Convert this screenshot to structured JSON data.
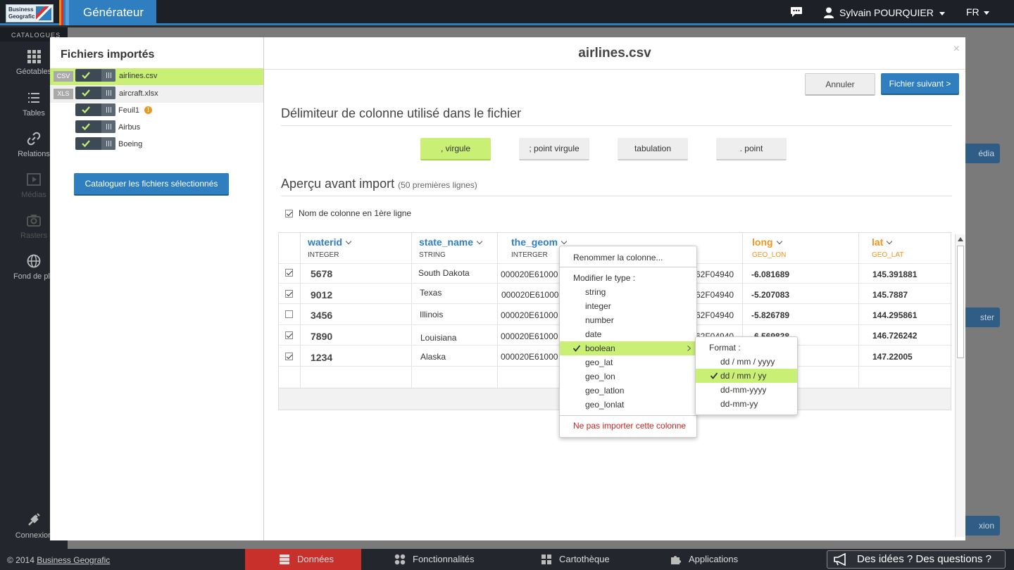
{
  "topbar": {
    "logo_line1": "Business",
    "logo_line2": "Geografic",
    "app_name": "Générateur",
    "user_name": "Sylvain POURQUIER",
    "language": "FR"
  },
  "sidebar": {
    "header": "CATALOGUES",
    "items": [
      {
        "label": "Géotables",
        "icon": "grid-icon"
      },
      {
        "label": "Tables",
        "icon": "list-icon"
      },
      {
        "label": "Relations",
        "icon": "link-icon"
      },
      {
        "label": "Médias",
        "icon": "film-icon"
      },
      {
        "label": "Rasters",
        "icon": "camera-icon"
      },
      {
        "label": "Fond de pla",
        "icon": "globe-icon"
      },
      {
        "label": "Connexion",
        "icon": "plug-icon"
      }
    ]
  },
  "background_buttons": [
    "édia",
    "ster",
    "xion"
  ],
  "files_panel": {
    "title": "Fichiers importés",
    "files": [
      {
        "type": "CSV",
        "name": "airlines.csv",
        "selected": true
      },
      {
        "type": "XLS",
        "name": "aircraft.xlsx",
        "selected": false
      },
      {
        "type": "",
        "name": "Feuil1",
        "warning": "!"
      },
      {
        "type": "",
        "name": "Airbus"
      },
      {
        "type": "",
        "name": "Boeing"
      }
    ],
    "catalog_button": "Cataloguer les fichiers sélectionnés"
  },
  "main": {
    "title": "airlines.csv",
    "close": "×",
    "cancel_button": "Annuler",
    "next_button": "Fichier suivant >",
    "delimiter_heading": "Délimiteur de colonne utilisé dans le fichier",
    "delimiters": [
      ", virgule",
      "; point virgule",
      "tabulation",
      ". point"
    ],
    "active_delimiter": ", virgule",
    "preview_heading": "Aperçu avant import",
    "preview_note": "(50 premières lignes)",
    "header_checkbox_label": "Nom de colonne en 1ère ligne"
  },
  "table": {
    "columns": [
      {
        "name": "waterid",
        "type": "INTEGER"
      },
      {
        "name": "state_name",
        "type": "STRING"
      },
      {
        "name": "the_geom",
        "type": "INTERGER"
      },
      {
        "name": "long",
        "type": "GEO_LON"
      },
      {
        "name": "lat",
        "type": "GEO_LAT"
      }
    ],
    "rows": [
      {
        "checked": true,
        "waterid": "5678",
        "state_name": "South Dakota",
        "geom": "000020E61000",
        "geom_tail": "62F04940",
        "long": "-6.081689",
        "lat": "145.391881"
      },
      {
        "checked": true,
        "waterid": "9012",
        "state_name": "Texas",
        "geom": "000020E61000",
        "geom_tail": "62F04940",
        "long": "-5.207083",
        "lat": "145.7887"
      },
      {
        "checked": false,
        "waterid": "3456",
        "state_name": "Illinois",
        "geom": "000020E61000",
        "geom_tail": "62F04940",
        "long": "-5.826789",
        "lat": "144.295861"
      },
      {
        "checked": true,
        "waterid": "7890",
        "state_name": "Louisiana",
        "geom": "000020E61000",
        "geom_tail": "62F04940",
        "long": "-6.569838",
        "lat": "146.726242"
      },
      {
        "checked": true,
        "waterid": "1234",
        "state_name": "Alaska",
        "geom": "000020E61000",
        "geom_tail": "",
        "long": "",
        "lat": "147.22005"
      }
    ]
  },
  "context_menu": {
    "rename": "Renommer la colonne...",
    "modify_type": "Modifier le type :",
    "types": [
      "string",
      "integer",
      "number",
      "date",
      "boolean",
      "geo_lat",
      "geo_lon",
      "geo_latlon",
      "geo_lonlat"
    ],
    "selected_type": "boolean",
    "exclude": "Ne pas importer cette colonne"
  },
  "format_submenu": {
    "title": "Format :",
    "options": [
      "dd / mm / yyyy",
      "dd / mm / yy",
      "dd-mm-yyyy",
      "dd-mm-yy"
    ],
    "selected": "dd / mm / yy"
  },
  "footer": {
    "copyright": "© 2014",
    "company_link": "Business Geografic",
    "tabs": [
      "Données",
      "Fonctionnalités",
      "Cartothèque",
      "Applications"
    ],
    "active_tab": "Données",
    "ideas_button": "Des idées ? Des questions ?"
  },
  "colors": {
    "accent_blue": "#2f7ec0",
    "selection_green": "#c9ef74",
    "active_footer_red": "#c7302b",
    "geo_orange": "#f0951e"
  }
}
